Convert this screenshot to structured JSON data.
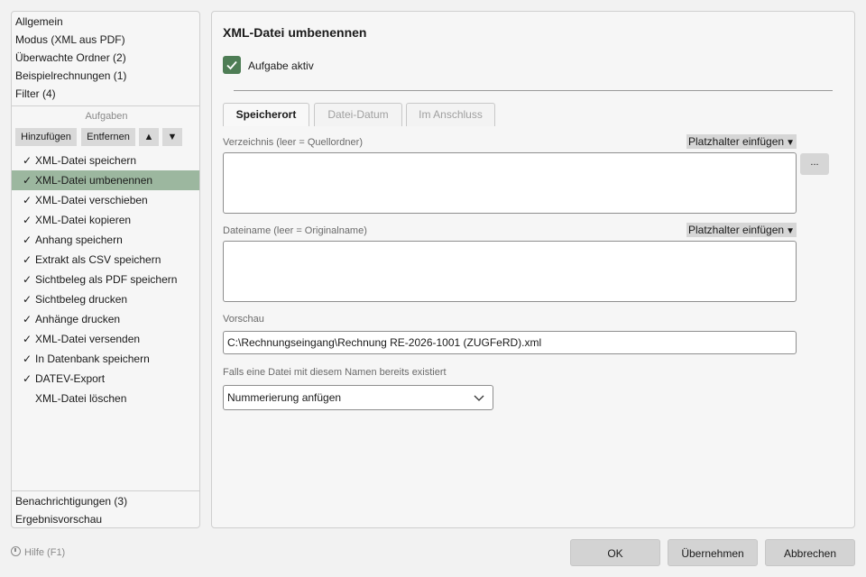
{
  "sidebar": {
    "top_items": [
      "Allgemein",
      "Modus (XML aus PDF)",
      "Überwachte Ordner (2)",
      "Beispielrechnungen (1)",
      "Filter (4)"
    ],
    "tasks_heading": "Aufgaben",
    "buttons": {
      "add": "Hinzufügen",
      "remove": "Entfernen",
      "up": "▲",
      "down": "▼"
    },
    "tasks": [
      {
        "label": "XML-Datei speichern",
        "checked": true
      },
      {
        "label": "XML-Datei umbenennen",
        "checked": true,
        "selected": true
      },
      {
        "label": "XML-Datei verschieben",
        "checked": true
      },
      {
        "label": "XML-Datei kopieren",
        "checked": true
      },
      {
        "label": "Anhang speichern",
        "checked": true
      },
      {
        "label": "Extrakt als CSV speichern",
        "checked": true
      },
      {
        "label": "Sichtbeleg als PDF speichern",
        "checked": true
      },
      {
        "label": "Sichtbeleg drucken",
        "checked": true
      },
      {
        "label": "Anhänge drucken",
        "checked": true
      },
      {
        "label": "XML-Datei versenden",
        "checked": true
      },
      {
        "label": "In Datenbank speichern",
        "checked": true
      },
      {
        "label": "DATEV-Export",
        "checked": true
      },
      {
        "label": "XML-Datei löschen",
        "checked": false
      }
    ],
    "check_mark": "✓",
    "bottom_items": [
      "Benachrichtigungen (3)",
      "Ergebnisvorschau"
    ]
  },
  "main": {
    "title": "XML-Datei umbenennen",
    "active_label": "Aufgabe aktiv",
    "tabs": [
      "Speicherort",
      "Datei-Datum",
      "Im Anschluss"
    ],
    "directory_label": "Verzeichnis (leer = Quellordner)",
    "placeholder_button": "Platzhalter einfügen",
    "browse_button": "...",
    "filename_label": "Dateiname (leer = Originalname)",
    "preview_label": "Vorschau",
    "preview_value": "C:\\Rechnungseingang\\Rechnung RE-2026-1001 (ZUGFeRD).xml",
    "conflict_label": "Falls eine Datei mit diesem Namen bereits existiert",
    "conflict_value": "Nummerierung anfügen"
  },
  "footer": {
    "help": "Hilfe (F1)",
    "ok": "OK",
    "apply": "Übernehmen",
    "cancel": "Abbrechen"
  },
  "colors": {
    "accent": "#4e7d55",
    "selected_row": "#9cb79f"
  }
}
